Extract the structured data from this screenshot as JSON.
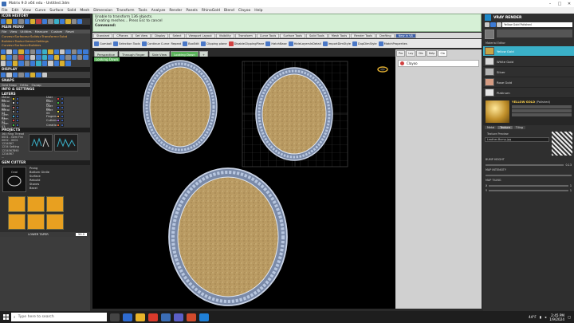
{
  "app": {
    "title": "Matrix 9.0 x64 edu - Untitled.3dm"
  },
  "menus": [
    "File",
    "Edit",
    "View",
    "Curve",
    "Surface",
    "Solid",
    "Mesh",
    "Dimension",
    "Transform",
    "Tools",
    "Analyze",
    "Render",
    "Panels",
    "RhinoGold",
    "Blend",
    "Clayoo",
    "Help"
  ],
  "left": {
    "icon_history": "ICON HISTORY",
    "main_menu": "MAIN MENU",
    "main_menu_items": [
      "File",
      "View",
      "Utilities",
      "Measure",
      "Custom",
      "Reset"
    ],
    "main_menu_lines": [
      "Curves>Surfaces>Solids>Transform>Subd",
      "Builder>Tools>Gems>Settings",
      "Curves>Surface>Builders"
    ],
    "display": "DISPLAY",
    "snaps": "SNAPS",
    "snap_opts": [
      "Grid Snap",
      "Ortho",
      "Osnap"
    ],
    "info_settings": "INFO & SETTINGS",
    "layers": "LAYERS",
    "layer_left": [
      "Metal 01",
      "Metal 02",
      "Metal 03",
      "Metal 04",
      "Gem 01",
      "Gem 02",
      "Gem 03"
    ],
    "layer_right": [
      "User 01",
      "User 02",
      "User 03",
      "User 04",
      "Fingers",
      "Cutters",
      "Creation"
    ],
    "projects": "PROJECTS",
    "project_lines": [
      "360 Ring Thread",
      "0001 - Gem Fini",
      "0002 - 0001",
      "1234567",
      "1234 Setting",
      "1234567890",
      "1234567",
      "..."
    ],
    "gem_cutter": "GEM CUTTER",
    "gem_shape": "Oval",
    "gem_opts": [
      "Prong",
      "Bottom Girdle",
      "Surface",
      "Rebuild",
      "Stones",
      "Bezel"
    ],
    "lower_taper": "LOWER TAPER",
    "lower_taper_value": "50.0"
  },
  "command": {
    "line1": "Unable to transform 136 objects.",
    "line2": "Creating meshes... Press Esc to cancel",
    "prompt": "Command:"
  },
  "toolbar_tabs": [
    "Standard",
    "CPlanes",
    "Set View",
    "Display",
    "Select",
    "Viewport Layout",
    "Visibility",
    "Transform",
    "Curve Tools",
    "Surface Tools",
    "Solid Tools",
    "Mesh Tools",
    "Render Tools",
    "Drafting",
    "New in V8"
  ],
  "tools": [
    "Gumball",
    "Selection Tools",
    "Continue Curve",
    "Repeat",
    "BoxEdit",
    "Clipping plane",
    "DisableClippingPlane",
    "HatchBase",
    "HideLayersInDetail",
    "ImportDimStyle",
    "DupDimStyle",
    "MatchProperties"
  ],
  "viewport_tabs": [
    "Perspective",
    "Through Finger",
    "Side View",
    "Looking Down"
  ],
  "viewport_label": "Looking Down",
  "right_strip": {
    "tabs": [
      "Pro",
      "Lay",
      "Dis",
      "Help",
      "Cla"
    ],
    "material": "Clayoo"
  },
  "vray": {
    "title": "VRAY RENDER",
    "selected_material": "Yellow Gold Polished",
    "material_list_label": "Material Editor",
    "materials": [
      "Yellow Gold",
      "White Gold",
      "Silver",
      "Rose Gold",
      "Platinum"
    ],
    "active_material_name": "YELLOW GOLD",
    "active_material_note": "(Polished)",
    "tabs": [
      "Metal",
      "Texture",
      "Tiling"
    ],
    "texture_preview": "Texture Preview",
    "texture_file": "Leather-Bump.jpg",
    "bump_height": "BUMP HEIGHT",
    "bump_value": "0.13",
    "map_intensity": "MAP INTENSITY",
    "map_tiling": "MAP TILING",
    "tiling_x": "1",
    "tiling_y": "1"
  },
  "taskbar": {
    "search_placeholder": "Type here to search",
    "weather": "44°F",
    "time": "2:45 PM",
    "date": "1/9/2024"
  },
  "colors": {
    "command_bg": "#d6f0d6",
    "accent_blue": "#3a5da8",
    "active_green": "#5ab45a",
    "vray_active": "#3ab0c8"
  }
}
